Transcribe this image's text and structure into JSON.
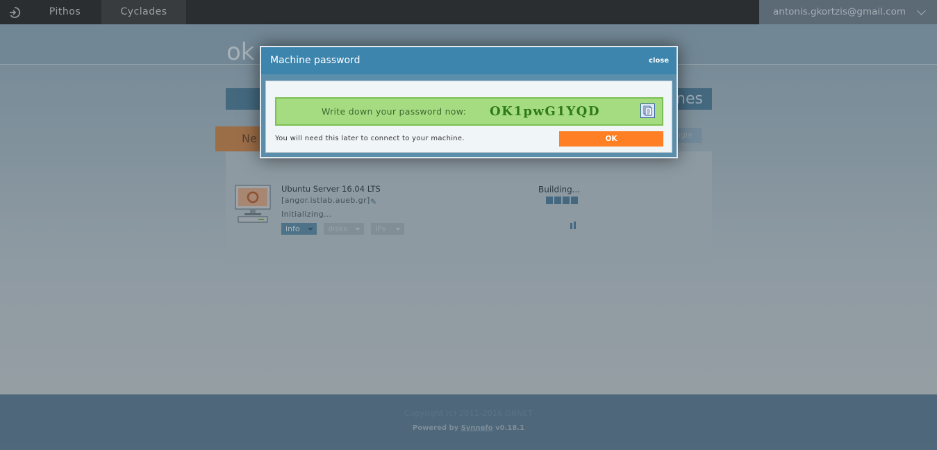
{
  "topbar": {
    "home_icon": "logout-arrow-icon",
    "nav_pithos": "Pithos",
    "nav_cyclades": "Cyclades",
    "user_email": "antonis.gkortzis@gmail.com"
  },
  "page": {
    "logo_text": "ok",
    "tab_right_text": "nes",
    "new_button": "Ne",
    "single_button": "ngle"
  },
  "vm": {
    "name": "Ubuntu Server 16.04 LTS",
    "host": "[angor.istlab.aueb.gr]",
    "state": "Initializing...",
    "status": "Building...",
    "progress_steps": 4,
    "tabs": [
      "info",
      "disks",
      "IPs"
    ]
  },
  "footer": {
    "copyright": "Copyright (c) 2011-2016 GRNET",
    "powered_prefix": "Powered by ",
    "powered_link": "Synnefo",
    "version": " v0.18.1"
  },
  "modal": {
    "title": "Machine password",
    "close": "close",
    "prompt": "Write down your password now:",
    "password": "OK1pwG1YQD",
    "note": "You will need this later to connect to your machine.",
    "ok": "OK"
  },
  "colors": {
    "modal_header": "#3d85ad",
    "password_box": "#a6dc81",
    "ok_button": "#ff7f24",
    "topbar": "#2b2b2b"
  }
}
